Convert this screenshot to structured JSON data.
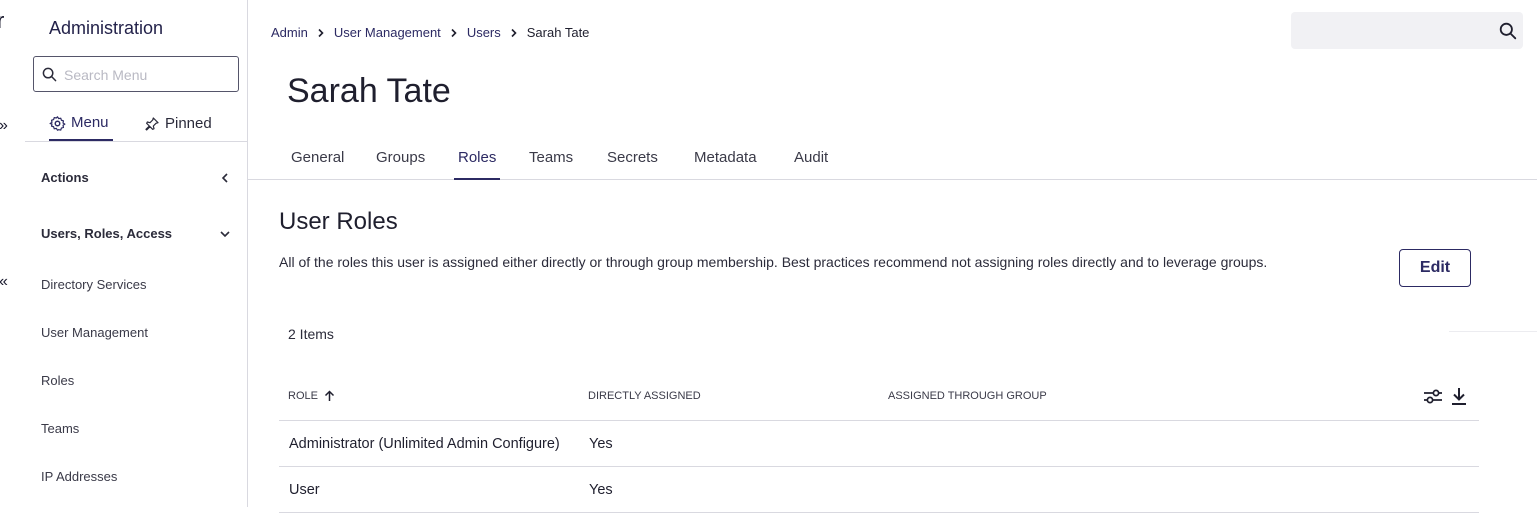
{
  "rail": {
    "title_fragment": "r",
    "expand_glyph": "»",
    "collapse_glyph": "«"
  },
  "sidebar": {
    "title": "Administration",
    "search_placeholder": "Search Menu",
    "tabs": [
      {
        "label": "Menu",
        "icon": "gear-icon"
      },
      {
        "label": "Pinned",
        "icon": "pin-icon"
      }
    ],
    "sections": [
      {
        "label": "Actions",
        "state": "collapsed"
      },
      {
        "label": "Users, Roles, Access",
        "state": "expanded"
      }
    ],
    "items": [
      "Directory Services",
      "User Management",
      "Roles",
      "Teams",
      "IP Addresses"
    ]
  },
  "breadcrumb": [
    "Admin",
    "User Management",
    "Users",
    "Sarah Tate"
  ],
  "top_search": {
    "value": "",
    "icon": "search-icon"
  },
  "page": {
    "title": "Sarah Tate"
  },
  "tabs": [
    "General",
    "Groups",
    "Roles",
    "Teams",
    "Secrets",
    "Metadata",
    "Audit"
  ],
  "active_tab": "Roles",
  "section": {
    "title": "User Roles",
    "description": "All of the roles this user is assigned either directly or through group membership. Best practices recommend not assigning roles directly and to leverage groups.",
    "edit_label": "Edit",
    "items_count": "2 Items"
  },
  "table": {
    "columns": [
      "ROLE",
      "DIRECTLY ASSIGNED",
      "ASSIGNED THROUGH GROUP"
    ],
    "sort_column": "ROLE",
    "sort_direction": "ascending",
    "rows": [
      {
        "role": "Administrator (Unlimited Admin Configure)",
        "direct": "Yes",
        "group": ""
      },
      {
        "role": "User",
        "direct": "Yes",
        "group": ""
      }
    ]
  },
  "colors": {
    "accent": "#2c2a63",
    "border": "#d9d9e0",
    "search_bg": "#f1f1f4"
  }
}
